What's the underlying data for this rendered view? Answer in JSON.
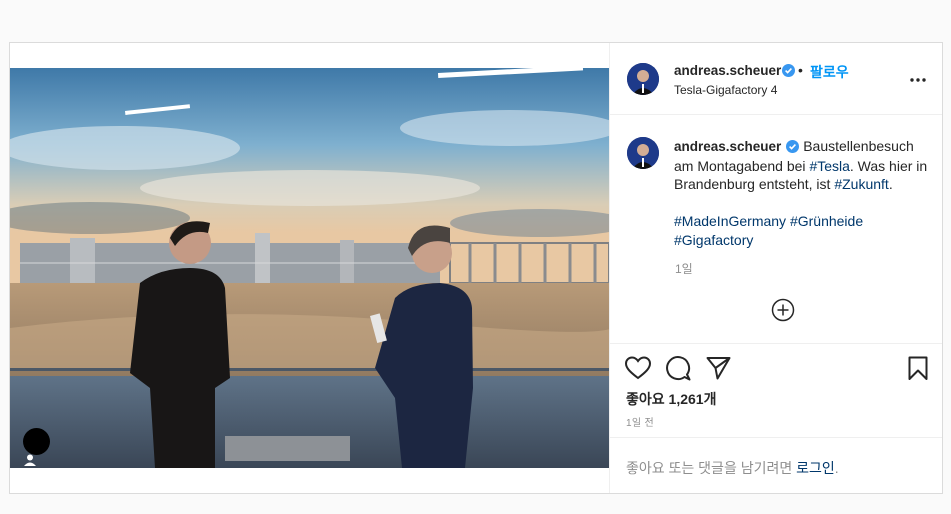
{
  "post": {
    "media": {
      "alt": "",
      "user_tag_icon": "user-icon"
    },
    "header": {
      "username": "andreas.scheuer",
      "verified_icon": "verified-badge-icon",
      "separator": "•",
      "follow_label": "팔로우",
      "location": "Tesla-Gigafactory 4",
      "more_icon": "more-options-icon"
    },
    "caption": {
      "username": "andreas.scheuer",
      "text_1": "Baustellenbesuch am Montagabend bei ",
      "tag_tesla": "#Tesla",
      "text_2": ". Was hier in Brandenburg entsteht, ist ",
      "tag_zukunft": "#Zukunft",
      "text_3": ".",
      "tag_madeingermany": "#MadeInGermany",
      "tag_gruenheide": "#Grünheide",
      "tag_gigafactory": "#Gigafactory",
      "time": "1일"
    },
    "load_more_icon": "plus-circle-icon",
    "actions": {
      "like_icon": "heart-icon",
      "comment_icon": "comment-icon",
      "share_icon": "send-icon",
      "save_icon": "bookmark-icon"
    },
    "likes": "좋아요 1,261개",
    "posted_ago": "1일 전",
    "login_prompt": {
      "text": "좋아요 또는 댓글을 남기려면 ",
      "link": "로그인",
      "end": "."
    },
    "colors": {
      "accent": "#0095f6",
      "hashtag": "#00376b",
      "muted": "#8e8e8e",
      "border": "#dbdbdb"
    }
  }
}
